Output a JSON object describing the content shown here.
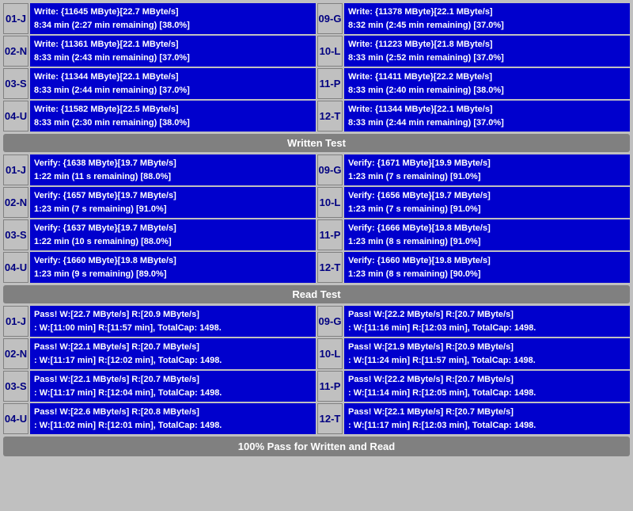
{
  "sections": {
    "write": {
      "rows": [
        {
          "left_id": "01-J",
          "left_line1": "Write: {11645 MByte}[22.7 MByte/s]",
          "left_line2": "8:34 min (2:27 min remaining)  [38.0%]",
          "right_id": "09-G",
          "right_line1": "Write: {11378 MByte}[22.1 MByte/s]",
          "right_line2": "8:32 min (2:45 min remaining)  [37.0%]"
        },
        {
          "left_id": "02-N",
          "left_line1": "Write: {11361 MByte}[22.1 MByte/s]",
          "left_line2": "8:33 min (2:43 min remaining)  [37.0%]",
          "right_id": "10-L",
          "right_line1": "Write: {11223 MByte}[21.8 MByte/s]",
          "right_line2": "8:33 min (2:52 min remaining)  [37.0%]"
        },
        {
          "left_id": "03-S",
          "left_line1": "Write: {11344 MByte}[22.1 MByte/s]",
          "left_line2": "8:33 min (2:44 min remaining)  [37.0%]",
          "right_id": "11-P",
          "right_line1": "Write: {11411 MByte}[22.2 MByte/s]",
          "right_line2": "8:33 min (2:40 min remaining)  [38.0%]"
        },
        {
          "left_id": "04-U",
          "left_line1": "Write: {11582 MByte}[22.5 MByte/s]",
          "left_line2": "8:33 min (2:30 min remaining)  [38.0%]",
          "right_id": "12-T",
          "right_line1": "Write: {11344 MByte}[22.1 MByte/s]",
          "right_line2": "8:33 min (2:44 min remaining)  [37.0%]"
        }
      ]
    },
    "written_test_label": "Written Test",
    "verify": {
      "rows": [
        {
          "left_id": "01-J",
          "left_line1": "Verify: {1638 MByte}[19.7 MByte/s]",
          "left_line2": "1:22 min (11 s remaining)  [88.0%]",
          "right_id": "09-G",
          "right_line1": "Verify: {1671 MByte}[19.9 MByte/s]",
          "right_line2": "1:23 min (7 s remaining)  [91.0%]"
        },
        {
          "left_id": "02-N",
          "left_line1": "Verify: {1657 MByte}[19.7 MByte/s]",
          "left_line2": "1:23 min (7 s remaining)  [91.0%]",
          "right_id": "10-L",
          "right_line1": "Verify: {1656 MByte}[19.7 MByte/s]",
          "right_line2": "1:23 min (7 s remaining)  [91.0%]"
        },
        {
          "left_id": "03-S",
          "left_line1": "Verify: {1637 MByte}[19.7 MByte/s]",
          "left_line2": "1:22 min (10 s remaining)  [88.0%]",
          "right_id": "11-P",
          "right_line1": "Verify: {1666 MByte}[19.8 MByte/s]",
          "right_line2": "1:23 min (8 s remaining)  [91.0%]"
        },
        {
          "left_id": "04-U",
          "left_line1": "Verify: {1660 MByte}[19.8 MByte/s]",
          "left_line2": "1:23 min (9 s remaining)  [89.0%]",
          "right_id": "12-T",
          "right_line1": "Verify: {1660 MByte}[19.8 MByte/s]",
          "right_line2": "1:23 min (8 s remaining)  [90.0%]"
        }
      ]
    },
    "read_test_label": "Read Test",
    "pass": {
      "rows": [
        {
          "left_id": "01-J",
          "left_line1": "Pass! W:[22.7 MByte/s] R:[20.9 MByte/s]",
          "left_line2": ": W:[11:00 min] R:[11:57 min], TotalCap: 1498.",
          "right_id": "09-G",
          "right_line1": "Pass! W:[22.2 MByte/s] R:[20.7 MByte/s]",
          "right_line2": ": W:[11:16 min] R:[12:03 min], TotalCap: 1498."
        },
        {
          "left_id": "02-N",
          "left_line1": "Pass! W:[22.1 MByte/s] R:[20.7 MByte/s]",
          "left_line2": ": W:[11:17 min] R:[12:02 min], TotalCap: 1498.",
          "right_id": "10-L",
          "right_line1": "Pass! W:[21.9 MByte/s] R:[20.9 MByte/s]",
          "right_line2": ": W:[11:24 min] R:[11:57 min], TotalCap: 1498."
        },
        {
          "left_id": "03-S",
          "left_line1": "Pass! W:[22.1 MByte/s] R:[20.7 MByte/s]",
          "left_line2": ": W:[11:17 min] R:[12:04 min], TotalCap: 1498.",
          "right_id": "11-P",
          "right_line1": "Pass! W:[22.2 MByte/s] R:[20.7 MByte/s]",
          "right_line2": ": W:[11:14 min] R:[12:05 min], TotalCap: 1498."
        },
        {
          "left_id": "04-U",
          "left_line1": "Pass! W:[22.6 MByte/s] R:[20.8 MByte/s]",
          "left_line2": ": W:[11:02 min] R:[12:01 min], TotalCap: 1498.",
          "right_id": "12-T",
          "right_line1": "Pass! W:[22.1 MByte/s] R:[20.7 MByte/s]",
          "right_line2": ": W:[11:17 min] R:[12:03 min], TotalCap: 1498."
        }
      ]
    },
    "footer_label": "100% Pass for Written and Read"
  }
}
